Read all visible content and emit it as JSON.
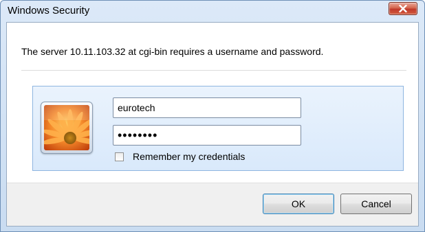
{
  "window": {
    "title": "Windows Security"
  },
  "dialog": {
    "message": "The server 10.11.103.32 at cgi-bin requires a username and password.",
    "username_value": "eurotech",
    "password_mask": "••••••••",
    "remember_label": "Remember my credentials",
    "remember_checked": false
  },
  "buttons": {
    "ok_label": "OK",
    "cancel_label": "Cancel"
  },
  "icons": {
    "close": "close-icon",
    "avatar": "user-tile-flower-icon"
  },
  "colors": {
    "close_button": "#c0392b",
    "panel_border": "#8eb5e0",
    "ok_border": "#3c7fb1"
  }
}
